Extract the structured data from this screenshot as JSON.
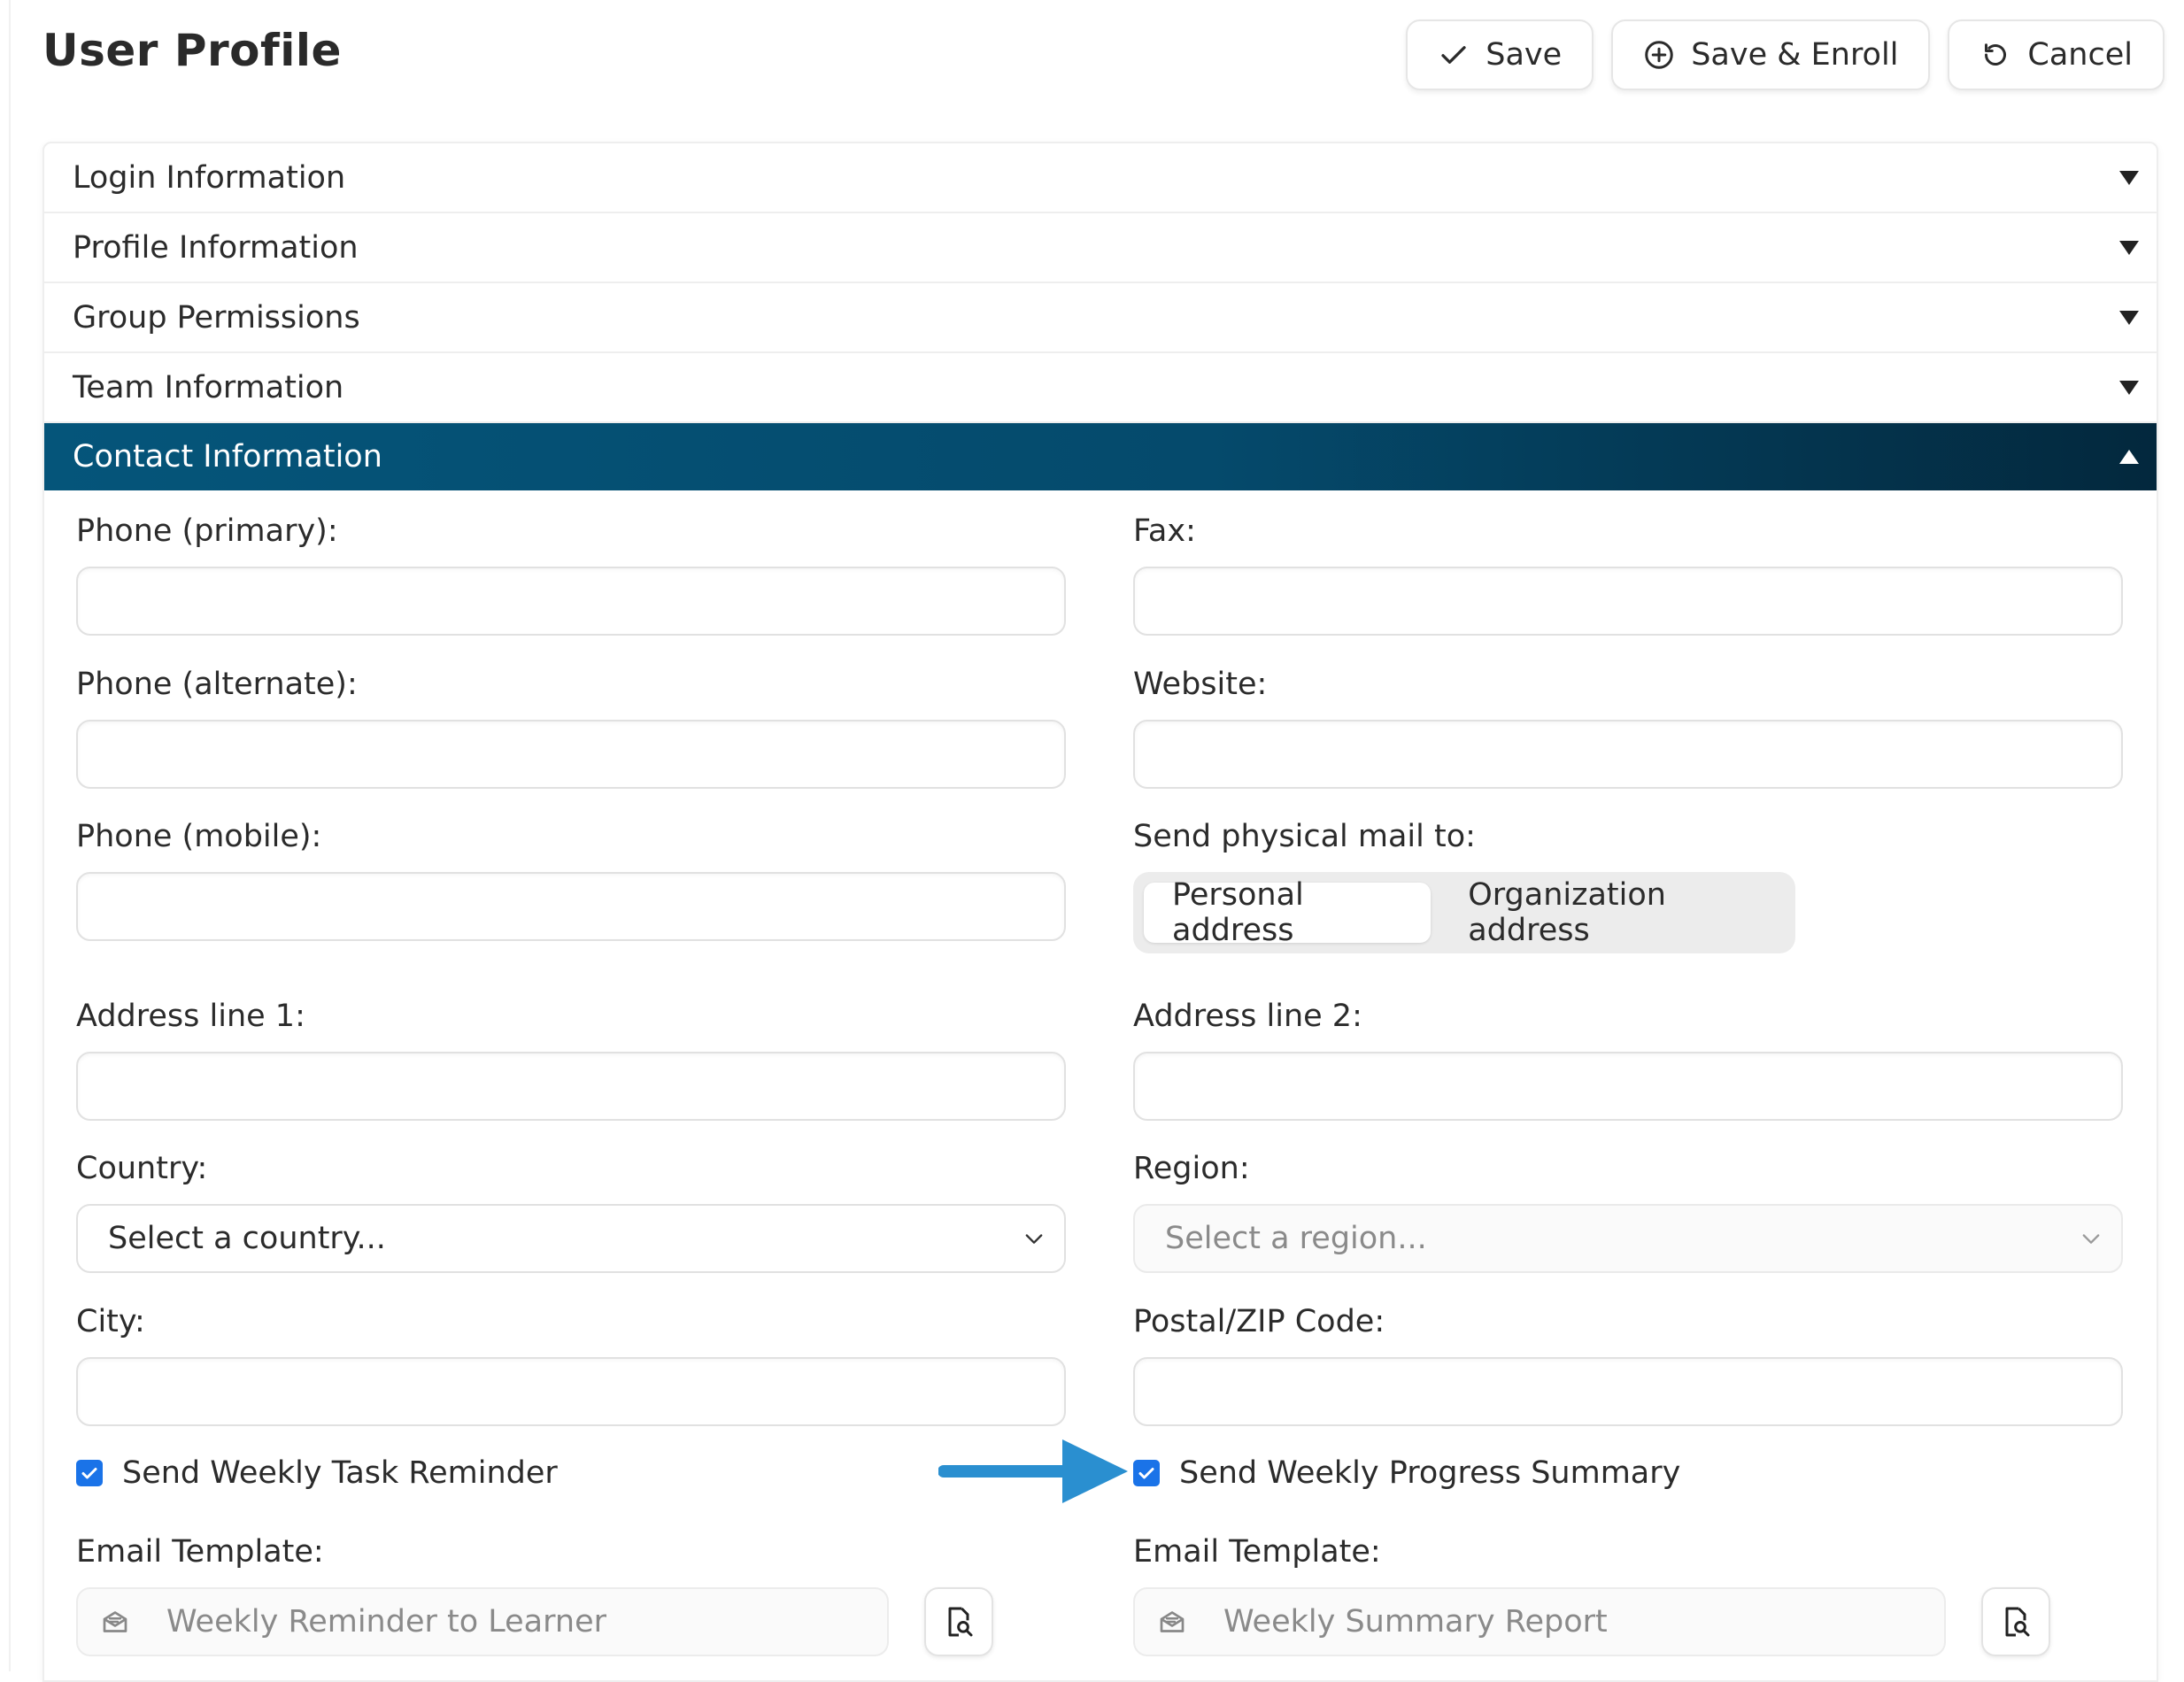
{
  "page": {
    "title": "User Profile"
  },
  "toolbar": {
    "save_label": "Save",
    "save_enroll_label": "Save & Enroll",
    "cancel_label": "Cancel"
  },
  "sections": [
    {
      "label": "Login Information",
      "expanded": false
    },
    {
      "label": "Profile Information",
      "expanded": false
    },
    {
      "label": "Group Permissions",
      "expanded": false
    },
    {
      "label": "Team Information",
      "expanded": false
    },
    {
      "label": "Contact Information",
      "expanded": true
    }
  ],
  "contact": {
    "phone_primary_label": "Phone (primary):",
    "fax_label": "Fax:",
    "phone_alternate_label": "Phone (alternate):",
    "website_label": "Website:",
    "phone_mobile_label": "Phone (mobile):",
    "send_mail_label": "Send physical mail to:",
    "mail_options": [
      "Personal address",
      "Organization address"
    ],
    "mail_selected": "Personal address",
    "address1_label": "Address line 1:",
    "address2_label": "Address line 2:",
    "country_label": "Country:",
    "country_placeholder": "Select a country...",
    "region_label": "Region:",
    "region_placeholder": "Select a region...",
    "city_label": "City:",
    "postal_label": "Postal/ZIP Code:",
    "reminder_label": "Send Weekly Task Reminder",
    "reminder_checked": true,
    "summary_label": "Send Weekly Progress Summary",
    "summary_checked": true,
    "email_template_label_left": "Email Template:",
    "email_template_label_right": "Email Template:",
    "template_left_value": "Weekly Reminder to Learner",
    "template_right_value": "Weekly Summary Report"
  },
  "colors": {
    "active_header": "#05557a",
    "checkbox": "#1a73e8",
    "annotation_arrow": "#2a8fd0"
  }
}
